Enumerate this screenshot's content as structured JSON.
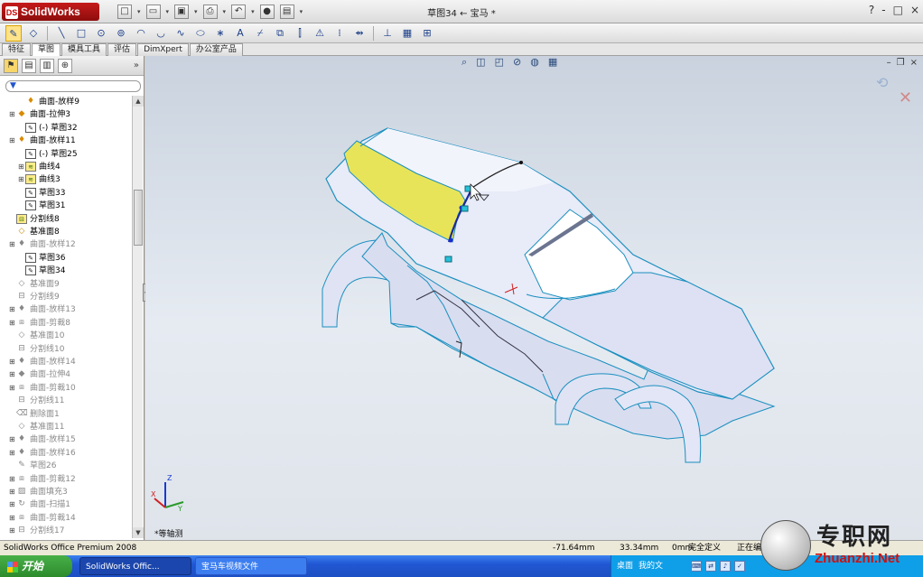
{
  "app": {
    "logo_text": "SolidWorks",
    "window_title": "草图34 ← 宝马 *",
    "win_controls": [
      "?",
      "-",
      "□",
      "×"
    ]
  },
  "tabs": [
    "特征",
    "草图",
    "模具工具",
    "评估",
    "DimXpert",
    "办公室产品"
  ],
  "active_tab": "草图",
  "tree": [
    {
      "label": "曲面-放样9",
      "icon": "loft-surface-icon",
      "dim": false
    },
    {
      "label": "曲面-拉伸3",
      "icon": "extrude-surface-icon",
      "dim": false
    },
    {
      "label": "(-) 草图32",
      "icon": "sketch-icon",
      "dim": false
    },
    {
      "label": "曲面-放样11",
      "icon": "loft-surface-icon",
      "dim": false
    },
    {
      "label": "(-) 草图25",
      "icon": "sketch-icon",
      "dim": false
    },
    {
      "label": "曲线4",
      "icon": "curve-icon",
      "dim": false
    },
    {
      "label": "曲线3",
      "icon": "curve-icon",
      "dim": false
    },
    {
      "label": "草图33",
      "icon": "sketch-icon",
      "dim": false
    },
    {
      "label": "草图31",
      "icon": "sketch-icon",
      "dim": false
    },
    {
      "label": "分割线8",
      "icon": "split-line-icon",
      "dim": false
    },
    {
      "label": "基准面8",
      "icon": "plane-icon",
      "dim": false
    },
    {
      "label": "曲面-放样12",
      "icon": "loft-surface-icon",
      "dim": true
    },
    {
      "label": "草图36",
      "icon": "sketch-icon",
      "dim": false
    },
    {
      "label": "草图34",
      "icon": "sketch-icon",
      "dim": false
    },
    {
      "label": "基准面9",
      "icon": "plane-icon",
      "dim": true
    },
    {
      "label": "分割线9",
      "icon": "split-line-icon",
      "dim": true
    },
    {
      "label": "曲面-放样13",
      "icon": "loft-surface-icon",
      "dim": true
    },
    {
      "label": "曲面-剪裁8",
      "icon": "trim-surface-icon",
      "dim": true
    },
    {
      "label": "基准面10",
      "icon": "plane-icon",
      "dim": true
    },
    {
      "label": "分割线10",
      "icon": "split-line-icon",
      "dim": true
    },
    {
      "label": "曲面-放样14",
      "icon": "loft-surface-icon",
      "dim": true
    },
    {
      "label": "曲面-拉伸4",
      "icon": "extrude-surface-icon",
      "dim": true
    },
    {
      "label": "曲面-剪裁10",
      "icon": "trim-surface-icon",
      "dim": true
    },
    {
      "label": "分割线11",
      "icon": "split-line-icon",
      "dim": true
    },
    {
      "label": "删除面1",
      "icon": "delete-face-icon",
      "dim": true
    },
    {
      "label": "基准面11",
      "icon": "plane-icon",
      "dim": true
    },
    {
      "label": "曲面-放样15",
      "icon": "loft-surface-icon",
      "dim": true
    },
    {
      "label": "曲面-放样16",
      "icon": "loft-surface-icon",
      "dim": true
    },
    {
      "label": "草图26",
      "icon": "sketch-icon",
      "dim": true
    },
    {
      "label": "曲面-剪裁12",
      "icon": "trim-surface-icon",
      "dim": true
    },
    {
      "label": "曲面填充3",
      "icon": "fill-surface-icon",
      "dim": true
    },
    {
      "label": "曲面-扫描1",
      "icon": "sweep-surface-icon",
      "dim": true
    },
    {
      "label": "曲面-剪裁14",
      "icon": "trim-surface-icon",
      "dim": true
    },
    {
      "label": "分割线17",
      "icon": "split-line-icon",
      "dim": true
    }
  ],
  "viewport": {
    "view_name": "*等轴测",
    "triad_labels": [
      "Z",
      "Y",
      "X"
    ]
  },
  "status": {
    "app_name": "SolidWorks Office Premium 2008",
    "x": "-71.64mm",
    "y": "33.34mm",
    "z": "0mm",
    "state": "完全定义",
    "editing": "正在编"
  },
  "taskbar": {
    "start": "开始",
    "task1": "SolidWorks Offic...",
    "task2": "宝马车视频文件",
    "tray_desktop": "桌面",
    "tray_docs": "我的文"
  },
  "watermark": {
    "cn": "专职网",
    "url": "Zhuanzhi.Net"
  },
  "colors": {
    "highlight_face": "#e7e45a",
    "edge": "#1a8fbf",
    "body": "#e8ebf8"
  }
}
